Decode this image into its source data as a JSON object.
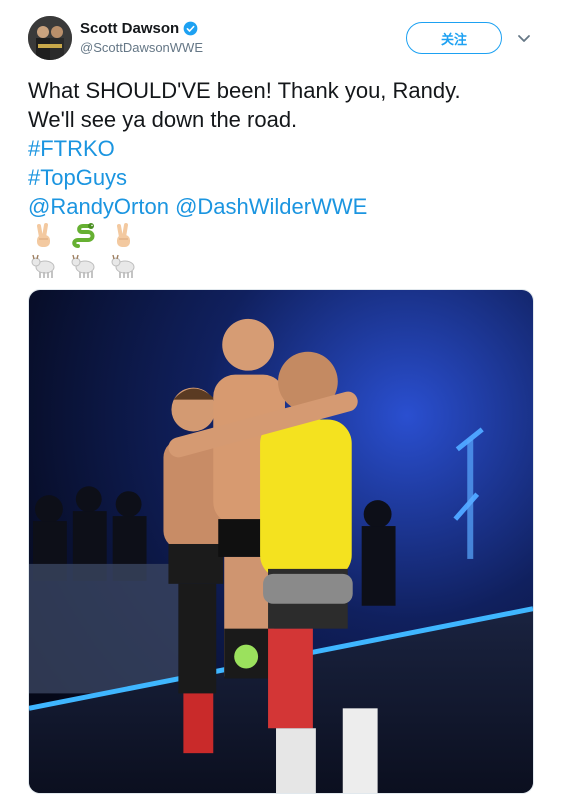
{
  "tweet": {
    "author": {
      "display_name": "Scott Dawson",
      "handle": "@ScottDawsonWWE",
      "verified": true
    },
    "follow_label": "关注",
    "text_lines": [
      "What SHOULD'VE been! Thank you, Randy.",
      "We'll see ya down the road."
    ],
    "hashtags": [
      "#FTRKO",
      "#TopGuys"
    ],
    "mentions": [
      "@RandyOrton",
      "@DashWilderWWE"
    ],
    "emoji_rows": [
      [
        "victory-hand",
        "snake",
        "victory-hand"
      ],
      [
        "goat",
        "goat",
        "goat"
      ]
    ],
    "colors": {
      "link": "#1b95e0",
      "follow_accent": "#1da1f2",
      "handle_gray": "#657786"
    }
  }
}
